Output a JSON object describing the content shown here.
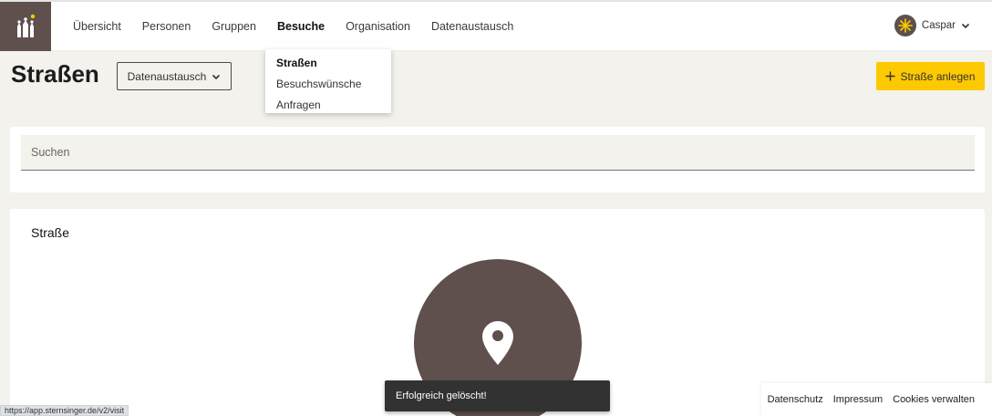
{
  "nav": {
    "items": [
      "Übersicht",
      "Personen",
      "Gruppen",
      "Besuche",
      "Organisation",
      "Datenaustausch"
    ],
    "active": "Besuche"
  },
  "user": {
    "name": "Caspar"
  },
  "dropdown": {
    "items": [
      "Straßen",
      "Besuchswünsche",
      "Anfragen"
    ],
    "active": "Straßen"
  },
  "page": {
    "title": "Straßen",
    "exchange_label": "Datenaustausch",
    "add_label": "Straße anlegen"
  },
  "search": {
    "placeholder": "Suchen"
  },
  "card": {
    "title": "Straße"
  },
  "toast": {
    "message": "Erfolgreich gelöscht!"
  },
  "footer": {
    "privacy": "Datenschutz",
    "imprint": "Impressum",
    "cookies": "Cookies verwalten"
  },
  "status_bar": {
    "url": "https://app.sternsinger.de/v2/visit"
  },
  "colors": {
    "brand_brown": "#5f504d",
    "accent_yellow": "#fdc900",
    "background": "#f3f2ec"
  }
}
